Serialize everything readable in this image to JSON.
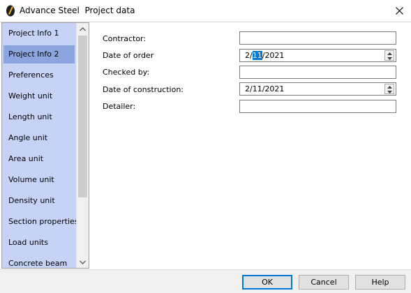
{
  "window": {
    "app_name": "Advance Steel",
    "dialog_name": "Project data",
    "title": "Advance Steel  Project data"
  },
  "nav": {
    "selected_index": 1,
    "items": [
      {
        "label": "Project Info 1"
      },
      {
        "label": "Project Info 2"
      },
      {
        "label": "Preferences"
      },
      {
        "label": "Weight unit"
      },
      {
        "label": "Length unit"
      },
      {
        "label": "Angle unit"
      },
      {
        "label": "Area unit"
      },
      {
        "label": "Volume unit"
      },
      {
        "label": "Density unit"
      },
      {
        "label": "Section properties"
      },
      {
        "label": "Load units"
      },
      {
        "label": "Concrete beam"
      }
    ]
  },
  "form": {
    "contractor": {
      "label": "Contractor:",
      "value": ""
    },
    "date_of_order": {
      "label": "Date of order",
      "value": "2/11/2021",
      "month": "2",
      "day": "11",
      "year": "2021",
      "sep": "/"
    },
    "checked_by": {
      "label": "Checked by:",
      "value": ""
    },
    "date_of_construction": {
      "label": "Date of construction:",
      "value": "2/11/2021"
    },
    "detailer": {
      "label": "Detailer:",
      "value": ""
    }
  },
  "buttons": {
    "ok": "OK",
    "cancel": "Cancel",
    "help": "Help"
  },
  "colors": {
    "nav_background": "#c6d3f7",
    "nav_selected": "#8da5de",
    "selection_highlight": "#0078d7",
    "default_button_border": "#0078d7"
  }
}
